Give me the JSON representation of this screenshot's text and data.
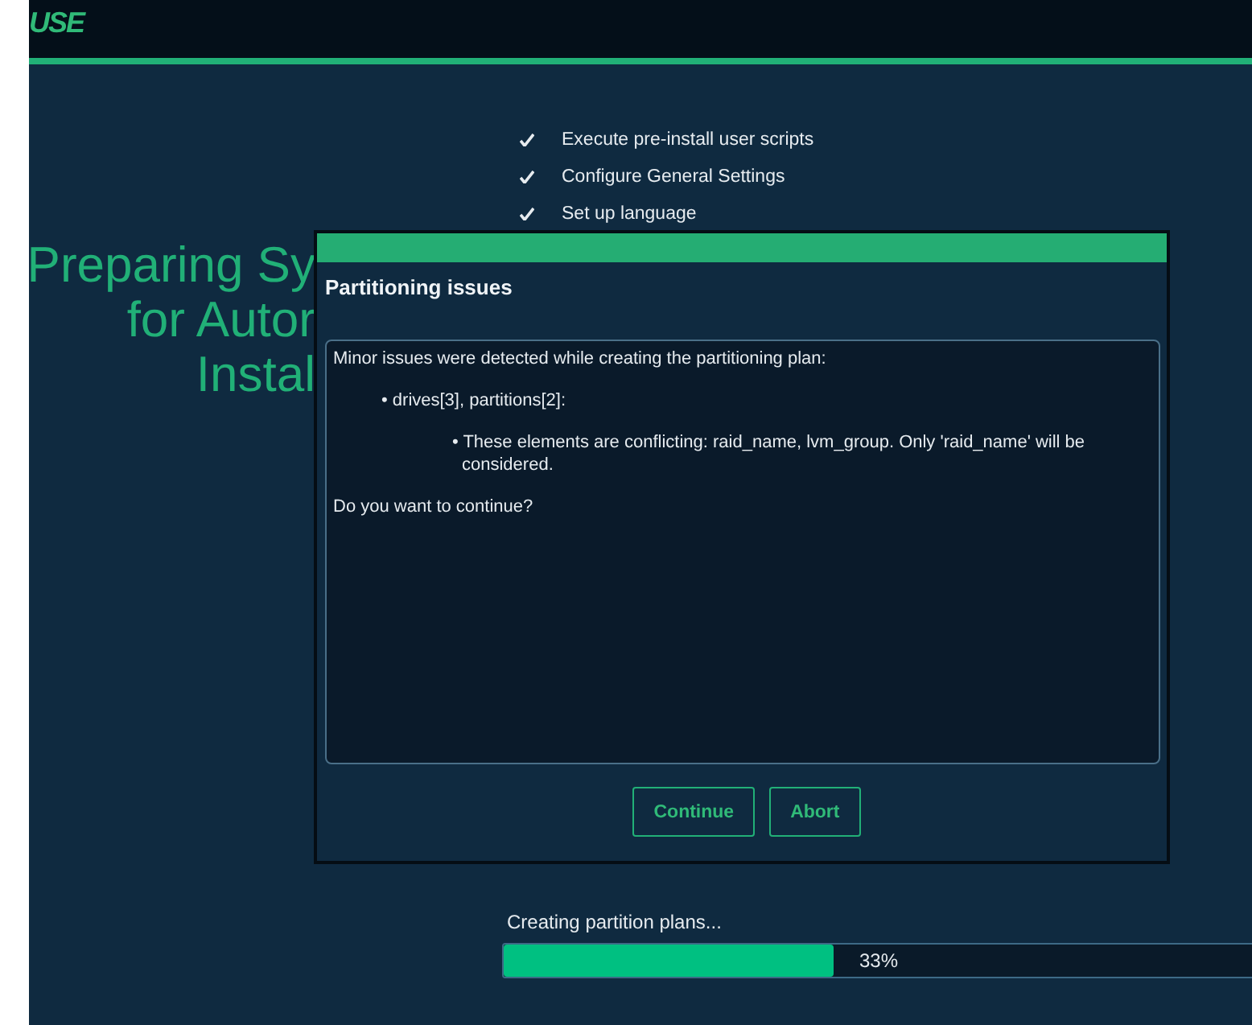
{
  "header": {
    "logo": "USE"
  },
  "steps": [
    {
      "label": "Execute pre-install user scripts",
      "done": true
    },
    {
      "label": "Configure General Settings",
      "done": true
    },
    {
      "label": "Set up language",
      "done": true
    }
  ],
  "heading": [
    "Preparing Sy",
    "for Autor",
    "Instal"
  ],
  "dialog": {
    "title": "Partitioning issues",
    "intro": "Minor issues were detected while creating the partitioning plan:",
    "issues": [
      {
        "text": "• drives[3], partitions[2]:",
        "children": [
          {
            "text": "• These elements are conflicting: raid_name, lvm_group. Only 'raid_name' will be considered."
          }
        ]
      }
    ],
    "question": "Do you want to continue?",
    "buttons": [
      {
        "label": "Continue"
      },
      {
        "label": "Abort"
      }
    ]
  },
  "progress": {
    "label": "Creating partition plans...",
    "level": 0.33,
    "reading": "33%"
  }
}
